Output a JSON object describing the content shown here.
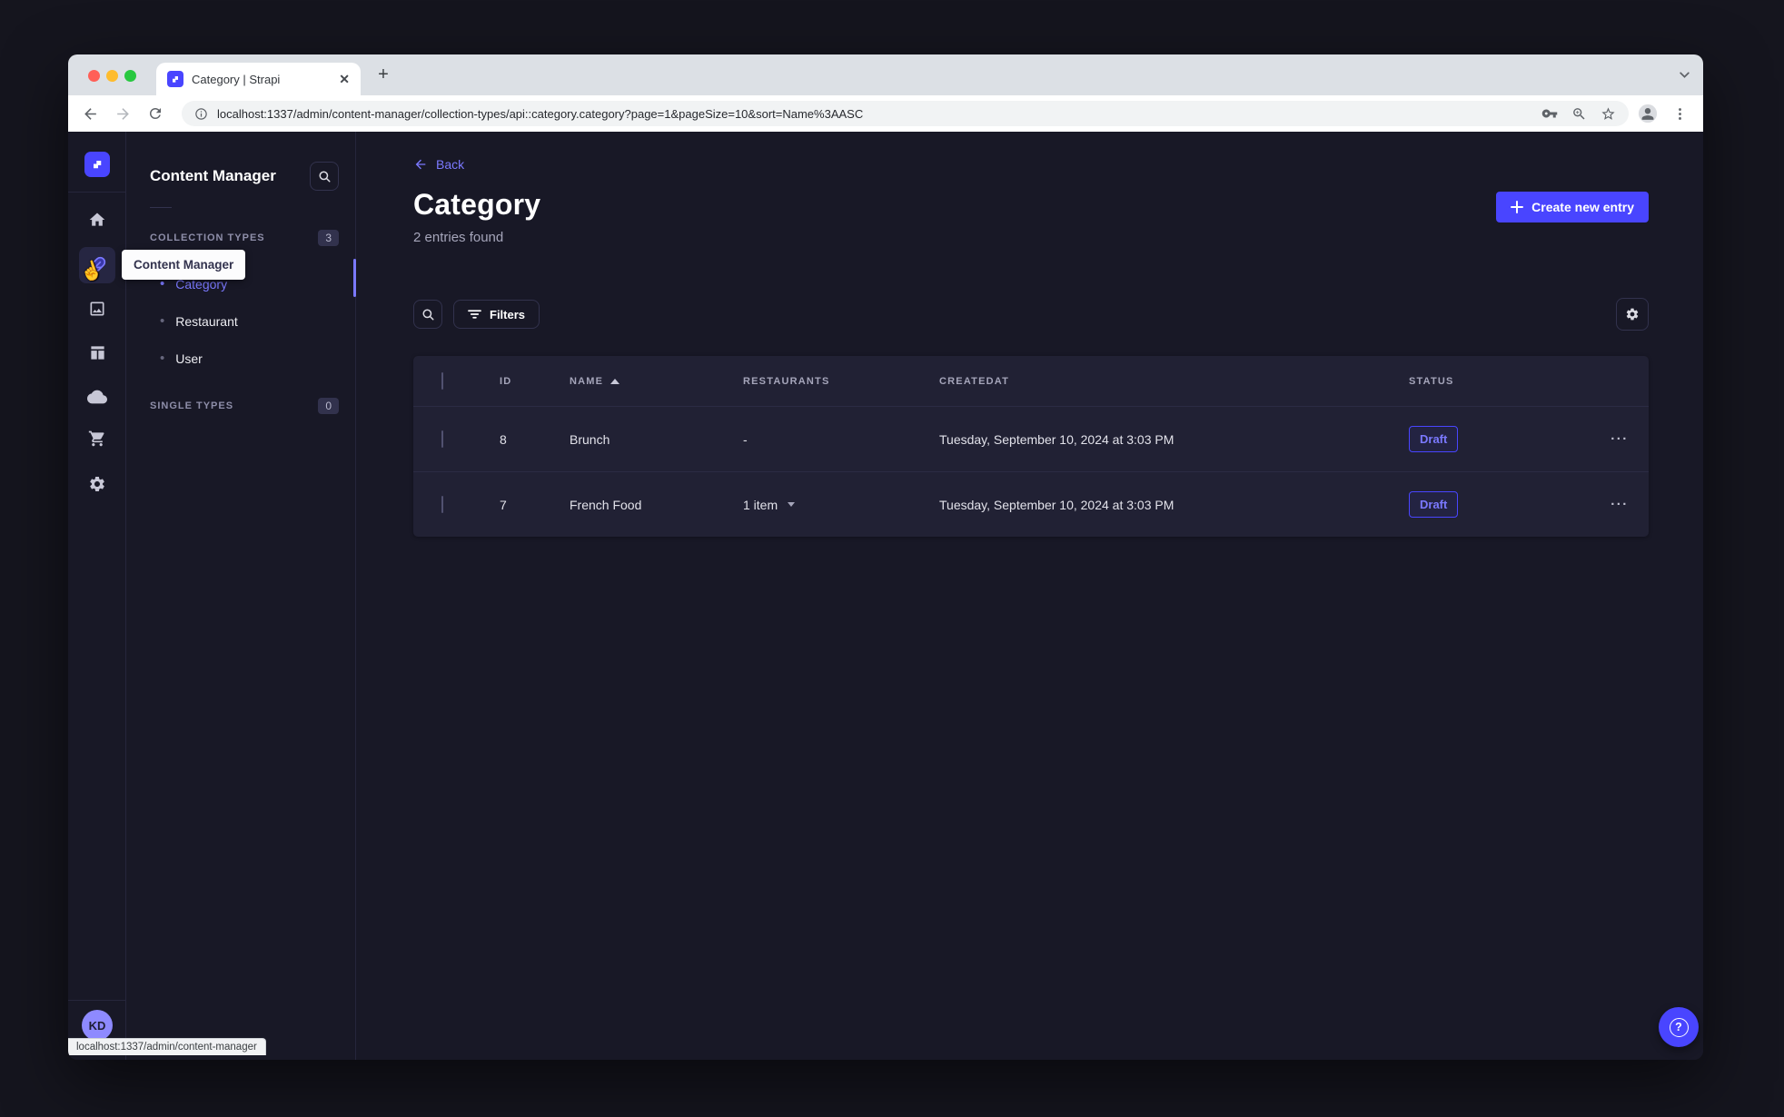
{
  "colors": {
    "accent": "#4945ff",
    "accent_light": "#7b79ff",
    "app_background": "#181826",
    "surface": "#212134",
    "border": "#32324d",
    "text_muted": "#a5a5ba"
  },
  "browser": {
    "tab_title": "Category | Strapi",
    "url": "localhost:1337/admin/content-manager/collection-types/api::category.category?page=1&pageSize=10&sort=Name%3AASC",
    "status_url": "localhost:1337/admin/content-manager"
  },
  "rail": {
    "tooltip": "Content Manager",
    "user_initials": "KD",
    "icons": [
      "strapi-logo",
      "home",
      "content-manager",
      "media-library",
      "content-type-builder",
      "cloud",
      "marketplace",
      "settings"
    ]
  },
  "subnav": {
    "title": "Content Manager",
    "collection_types": {
      "label": "COLLECTION TYPES",
      "count": "3",
      "items": [
        {
          "label": "Category",
          "active": true
        },
        {
          "label": "Restaurant",
          "active": false
        },
        {
          "label": "User",
          "active": false
        }
      ]
    },
    "single_types": {
      "label": "SINGLE TYPES",
      "count": "0"
    }
  },
  "main": {
    "back_label": "Back",
    "title": "Category",
    "subtitle": "2 entries found",
    "create_button_label": "Create new entry",
    "filters_button_label": "Filters",
    "table": {
      "columns": [
        "ID",
        "NAME",
        "RESTAURANTS",
        "CREATEDAT",
        "STATUS"
      ],
      "rows": [
        {
          "id": "8",
          "name": "Brunch",
          "restaurants": "-",
          "createdat": "Tuesday, September 10, 2024 at 3:03 PM",
          "status": "Draft"
        },
        {
          "id": "7",
          "name": "French Food",
          "restaurants": "1 item",
          "createdat": "Tuesday, September 10, 2024 at 3:03 PM",
          "status": "Draft"
        }
      ]
    }
  },
  "help": {
    "question_mark": "?"
  }
}
